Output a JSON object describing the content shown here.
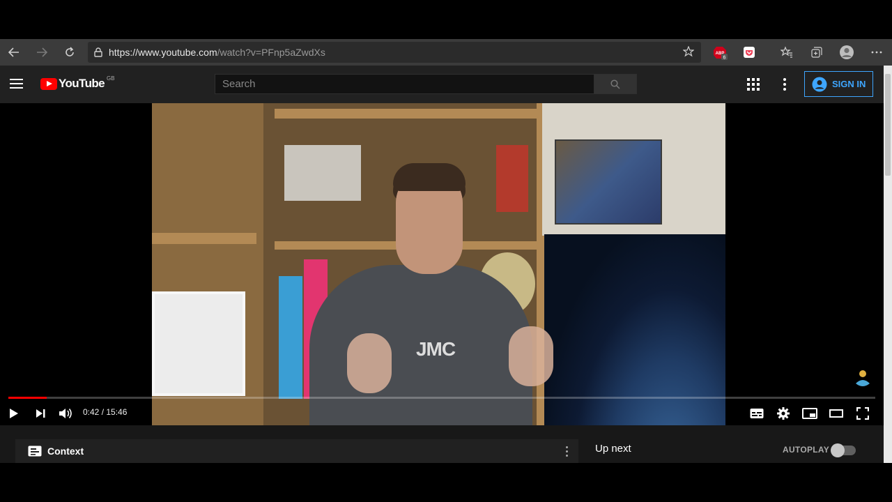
{
  "browser": {
    "url_host": "https://www.youtube.com",
    "url_path": "/watch?v=PFnp5aZwdXs",
    "icons": [
      "back-arrow-icon",
      "forward-arrow-icon",
      "refresh-icon",
      "lock-icon",
      "favorite-star-icon",
      "adblock-extension-icon",
      "pocket-extension-icon",
      "favorites-icon",
      "collections-icon",
      "profile-icon",
      "more-icon"
    ],
    "adblock_badge": "6"
  },
  "youtube": {
    "logo_text": "YouTube",
    "region": "GB",
    "search_placeholder": "Search",
    "sign_in_label": "SIGN IN"
  },
  "player": {
    "current_time": "0:42",
    "duration": "15:46",
    "time_display": "0:42 / 15:46",
    "progress_fraction": 0.044,
    "shirt_text": "JMC",
    "accent_color": "#ff0000"
  },
  "below": {
    "context_label": "Context",
    "up_next_label": "Up next",
    "autoplay_label": "AUTOPLAY",
    "autoplay_on": false
  }
}
